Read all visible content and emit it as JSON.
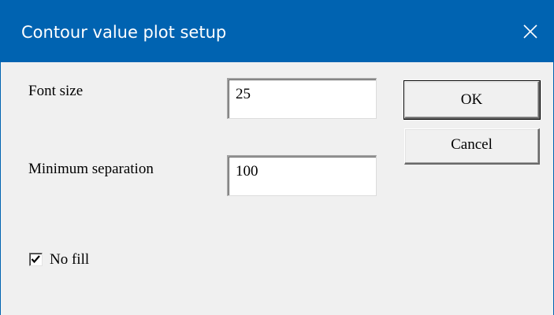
{
  "window": {
    "title": "Contour value plot setup",
    "close_glyph": "✕",
    "titlebar_color": "#0063b1",
    "background_color": "#f0f0f0"
  },
  "fields": {
    "font_size": {
      "label": "Font size",
      "value": "25"
    },
    "minimum_separation": {
      "label": "Minimum separation",
      "value": "100"
    }
  },
  "buttons": {
    "ok_label": "OK",
    "cancel_label": "Cancel"
  },
  "checkbox": {
    "label": "No fill",
    "checked": true
  }
}
